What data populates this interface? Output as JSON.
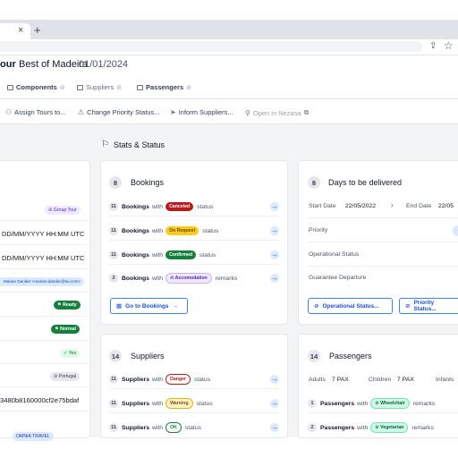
{
  "browser": {
    "tab_close": "×",
    "new_tab": "+"
  },
  "header": {
    "tour_label": "our",
    "tour_name": "Best of Madeira",
    "tour_date": "01/01/2024"
  },
  "tabs": [
    {
      "label": "Components",
      "active": true
    },
    {
      "label": "Suppliers",
      "active": false
    },
    {
      "label": "Passengers",
      "active": true
    }
  ],
  "actions": [
    {
      "label": "Assign Tours to..."
    },
    {
      "label": "Change Priority Status..."
    },
    {
      "label": "Inform Suppliers..."
    },
    {
      "label": "Open in Nezasa"
    }
  ],
  "section": {
    "title": "Stats & Status"
  },
  "left_card": {
    "group_badge": "Group Tour",
    "date_line_1": "DD/MM/YYYY HH:MM UTC",
    "date_line_2": "DD/MM/YYYY HH:MM UTC",
    "email_badge": "Marian Dander <marian.dander@tui.com>",
    "ready_badge": "Ready",
    "normal_badge": "Normal",
    "yes_badge": "Yes",
    "country_badge": "Portugal",
    "hash_text": "3480b8160000cf2e75bdaf",
    "bottom_badge": "OMNIA TRAVEL"
  },
  "bookings": {
    "count": "8",
    "title": "Bookings",
    "rows": [
      {
        "n": "11",
        "label": "Bookings",
        "with": "with",
        "pill": "Canceled",
        "suffix": "status"
      },
      {
        "n": "11",
        "label": "Bookings",
        "with": "with",
        "pill": "On Request",
        "suffix": "status"
      },
      {
        "n": "11",
        "label": "Bookings",
        "with": "with",
        "pill": "Confirmed",
        "suffix": "status"
      },
      {
        "n": "2",
        "label": "Bookings",
        "with": "with",
        "pill": "Accomodation",
        "suffix": "remarks"
      }
    ],
    "button": "Go to Bookings"
  },
  "days": {
    "count": "8",
    "title": "Days to be delivered",
    "start_label": "Start Date",
    "start_value": "22/05/2022",
    "end_label": "End Date",
    "end_value": "22/05",
    "priority_label": "Priority",
    "operational_label": "Operational Status",
    "guarantee_label": "Guarantee Departure",
    "btn_operational": "Operational Status...",
    "btn_priority": "Priority Status..."
  },
  "suppliers": {
    "count": "14",
    "title": "Suppliers",
    "rows": [
      {
        "n": "11",
        "label": "Suppliers",
        "with": "with",
        "pill": "Danger",
        "suffix": "status"
      },
      {
        "n": "11",
        "label": "Suppliers",
        "with": "with",
        "pill": "Warning",
        "suffix": "status"
      },
      {
        "n": "11",
        "label": "Suppliers",
        "with": "with",
        "pill": "OK",
        "suffix": "status"
      }
    ]
  },
  "passengers": {
    "count": "14",
    "title": "Passengers",
    "adults_label": "Adults",
    "adults_value": "7 PAX",
    "children_label": "Children",
    "children_value": "7 PAX",
    "infants_label": "Infants",
    "rows": [
      {
        "n": "1",
        "label": "Passengers",
        "with": "with",
        "pill": "Wheelchair",
        "suffix": "remarks"
      },
      {
        "n": "2",
        "label": "Passengers",
        "with": "with",
        "pill": "Vegetarian",
        "suffix": "remarks"
      }
    ]
  }
}
